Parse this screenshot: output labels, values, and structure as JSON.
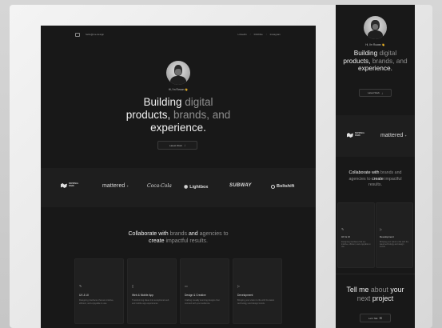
{
  "colors": {
    "page_bg": "#d0d0d0",
    "panel_bg": "#181818",
    "text_white": "#f0f0f0",
    "text_gray": "#8f8f8f",
    "accent_wave": "#f2c200"
  },
  "desktop": {
    "nav": {
      "domain": "hello@me.design",
      "links": [
        "LinkedIn",
        "Dribbble",
        "Instagram"
      ],
      "separator": "/"
    },
    "hero": {
      "greeting": "Hi, I'm Rowan",
      "wave": "👋",
      "title_line1_white": "Building",
      "title_line1_gray": "digital",
      "title_line2_white": "products,",
      "title_line2_gray1": "brands,",
      "title_line2_gray2": "and",
      "title_line3_white": "experience.",
      "cta_label": "Latest Work",
      "cta_icon": "arrow-down-icon"
    },
    "logos": [
      {
        "name": "national-bank",
        "text_line1": "NATIONAL",
        "text_line2": "BANK"
      },
      {
        "name": "mattered",
        "text": "mattered"
      },
      {
        "name": "coca-cola",
        "text": "Coca-Cola"
      },
      {
        "name": "lightbox",
        "text": "Lightbox"
      },
      {
        "name": "subway",
        "text": "SUBWAY"
      },
      {
        "name": "boltshift",
        "text": "Boltshift"
      }
    ],
    "collab": {
      "w1": "Collaborate with",
      "g1": "brands",
      "w2": "and",
      "g2": "agencies",
      "w3": "to",
      "line2_w": "create",
      "line2_g": "impactful results."
    },
    "services": [
      {
        "icon": "pen-icon",
        "title": "UX & UI",
        "desc": "Designing interfaces that are intuitive, efficient, and enjoyable to use."
      },
      {
        "icon": "phone-icon",
        "title": "Web & Mobile App",
        "desc": "Transforming ideas into exceptional web and mobile app experiences."
      },
      {
        "icon": "monitor-icon",
        "title": "Design & Creative",
        "desc": "Crafting visually stunning designs that connect with your audience."
      },
      {
        "icon": "play-icon",
        "title": "Development",
        "desc": "Bringing your vision to life with the latest technology and design trends."
      }
    ]
  },
  "mobile": {
    "greeting": "Hi, I'm Rowan",
    "wave": "👋",
    "title_line1_white": "Building",
    "title_line1_gray": "digital",
    "title_line2_white": "products,",
    "title_line2_gray": "brands, and",
    "title_line3_white": "experience.",
    "cta_label": "Latest Work",
    "logos": [
      {
        "name": "national-bank",
        "text_line1": "NATIONAL",
        "text_line2": "BANK"
      },
      {
        "name": "mattered",
        "text": "mattered"
      }
    ],
    "collab": {
      "line1_w": "Collaborate",
      "line1_w2": "with",
      "line1_g": "brands and",
      "line2_g": "agencies",
      "line2_w": "to",
      "line2_w2": "create",
      "line2_g2": "impactful",
      "line3_g": "results."
    },
    "services": [
      {
        "icon": "pen-icon",
        "title": "UX & UI",
        "desc": "Designing interfaces that are intuitive, efficient, and enjoyable to use."
      },
      {
        "icon": "play-icon",
        "title": "Development",
        "desc": "Bringing your vision to life with the latest technology and design trends."
      }
    ],
    "contact": {
      "w1": "Tell me",
      "g1": "about",
      "w2": "your",
      "line2_g": "next",
      "line2_w": "project",
      "cta_label": "Let's Talk",
      "cta_icon": "mail-icon"
    }
  }
}
